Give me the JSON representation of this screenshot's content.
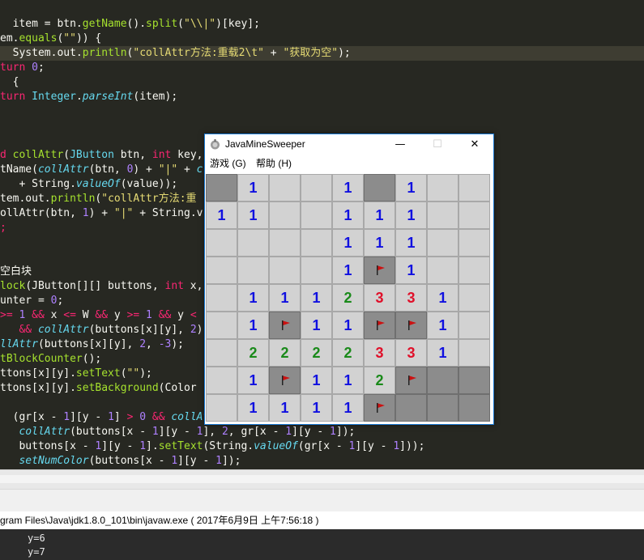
{
  "code": {
    "lines": [
      {
        "text": "",
        "parts": []
      },
      {
        "parts": [
          [
            "pl",
            "  item = btn."
          ],
          [
            "fn",
            "getName"
          ],
          [
            "pl",
            "()."
          ],
          [
            "fn",
            "split"
          ],
          [
            "pl",
            "("
          ],
          [
            "st",
            "\"\\\\|\""
          ],
          [
            "pl",
            ")["
          ],
          [
            "pl",
            "key"
          ],
          [
            "pl",
            "];"
          ]
        ]
      },
      {
        "parts": [
          [
            "pl",
            "em."
          ],
          [
            "fn",
            "equals"
          ],
          [
            "pl",
            "("
          ],
          [
            "st",
            "\"\""
          ],
          [
            "pl",
            ")) {"
          ]
        ]
      },
      {
        "hl": true,
        "parts": [
          [
            "pl",
            "  System.out."
          ],
          [
            "fn",
            "println"
          ],
          [
            "pl",
            "("
          ],
          [
            "st",
            "\"collAttr方法:重载2\\t\""
          ],
          [
            "pl",
            " + "
          ],
          [
            "st",
            "\"获取为空\""
          ],
          [
            "pl",
            ");"
          ]
        ]
      },
      {
        "parts": [
          [
            "kw",
            "turn"
          ],
          [
            "pl",
            " "
          ],
          [
            "nm",
            "0"
          ],
          [
            "pl",
            ";"
          ]
        ]
      },
      {
        "parts": [
          [
            "pl",
            "  {"
          ]
        ]
      },
      {
        "parts": [
          [
            "kw",
            "turn"
          ],
          [
            "pl",
            " "
          ],
          [
            "tyn",
            "Integer"
          ],
          [
            "pl",
            "."
          ],
          [
            "ty",
            "parseInt"
          ],
          [
            "pl",
            "(item);"
          ]
        ]
      },
      {
        "parts": []
      },
      {
        "parts": []
      },
      {
        "parts": []
      },
      {
        "parts": [
          [
            "kw",
            "d"
          ],
          [
            "pl",
            " "
          ],
          [
            "fn",
            "collAttr"
          ],
          [
            "pl",
            "("
          ],
          [
            "tyn",
            "JButton"
          ],
          [
            "pl",
            " btn, "
          ],
          [
            "kw",
            "int"
          ],
          [
            "pl",
            " key,"
          ]
        ]
      },
      {
        "parts": [
          [
            "pl",
            "tName("
          ],
          [
            "ty",
            "collAttr"
          ],
          [
            "pl",
            "(btn, "
          ],
          [
            "nm",
            "0"
          ],
          [
            "pl",
            ") + "
          ],
          [
            "st",
            "\"|\""
          ],
          [
            "pl",
            " + "
          ],
          [
            "ty",
            "c"
          ]
        ]
      },
      {
        "parts": [
          [
            "pl",
            "   + String."
          ],
          [
            "ty",
            "valueOf"
          ],
          [
            "pl",
            "(value));"
          ]
        ]
      },
      {
        "parts": [
          [
            "pl",
            "tem.out."
          ],
          [
            "fn",
            "println"
          ],
          [
            "pl",
            "("
          ],
          [
            "st",
            "\"collAttr方法:重"
          ]
        ]
      },
      {
        "parts": [
          [
            "pl",
            "ollAttr(btn, "
          ],
          [
            "nm",
            "1"
          ],
          [
            "pl",
            ") + "
          ],
          [
            "st",
            "\"|\""
          ],
          [
            "pl",
            " + String.v"
          ]
        ]
      },
      {
        "parts": [
          [
            "kw",
            ";"
          ]
        ]
      },
      {
        "parts": []
      },
      {
        "parts": []
      },
      {
        "parts": [
          [
            "pl",
            "空白块"
          ]
        ]
      },
      {
        "parts": [
          [
            "fn",
            "lock"
          ],
          [
            "pl",
            "(JButton[][] buttons, "
          ],
          [
            "kw",
            "int"
          ],
          [
            "pl",
            " x,"
          ]
        ]
      },
      {
        "parts": [
          [
            "pl",
            "unter = "
          ],
          [
            "nm",
            "0"
          ],
          [
            "pl",
            ";"
          ]
        ]
      },
      {
        "parts": [
          [
            "kw",
            ">="
          ],
          [
            "pl",
            " "
          ],
          [
            "nm",
            "1"
          ],
          [
            "pl",
            " "
          ],
          [
            "kw",
            "&&"
          ],
          [
            "pl",
            " x "
          ],
          [
            "kw",
            "<="
          ],
          [
            "pl",
            " W "
          ],
          [
            "kw",
            "&&"
          ],
          [
            "pl",
            " y "
          ],
          [
            "kw",
            ">="
          ],
          [
            "pl",
            " "
          ],
          [
            "nm",
            "1"
          ],
          [
            "pl",
            " "
          ],
          [
            "kw",
            "&&"
          ],
          [
            "pl",
            " y "
          ],
          [
            "kw",
            "<"
          ]
        ]
      },
      {
        "parts": [
          [
            "pl",
            "   "
          ],
          [
            "kw",
            "&&"
          ],
          [
            "pl",
            " "
          ],
          [
            "ty",
            "collAttr"
          ],
          [
            "pl",
            "(buttons[x][y], "
          ],
          [
            "nm",
            "2"
          ],
          [
            "pl",
            ")"
          ]
        ]
      },
      {
        "parts": [
          [
            "ty",
            "llAttr"
          ],
          [
            "pl",
            "(buttons[x][y], "
          ],
          [
            "nm",
            "2"
          ],
          [
            "pl",
            ", "
          ],
          [
            "nm",
            "-3"
          ],
          [
            "pl",
            ");"
          ]
        ]
      },
      {
        "parts": [
          [
            "fn",
            "tBlockCounter"
          ],
          [
            "pl",
            "();"
          ]
        ]
      },
      {
        "parts": [
          [
            "pl",
            "ttons[x][y]."
          ],
          [
            "fn",
            "setText"
          ],
          [
            "pl",
            "("
          ],
          [
            "st",
            "\"\""
          ],
          [
            "pl",
            ");"
          ]
        ]
      },
      {
        "parts": [
          [
            "pl",
            "ttons[x][y]."
          ],
          [
            "fn",
            "setBackground"
          ],
          [
            "pl",
            "(Color"
          ]
        ]
      },
      {
        "parts": []
      },
      {
        "parts": [
          [
            "pl",
            "  ("
          ],
          [
            "pl",
            "gr[x - "
          ],
          [
            "nm",
            "1"
          ],
          [
            "pl",
            "][y - "
          ],
          [
            "nm",
            "1"
          ],
          [
            "pl",
            "] "
          ],
          [
            "kw",
            ">"
          ],
          [
            "pl",
            " "
          ],
          [
            "nm",
            "0"
          ],
          [
            "pl",
            " "
          ],
          [
            "kw",
            "&&"
          ],
          [
            "pl",
            " "
          ],
          [
            "ty",
            "collAtt"
          ]
        ]
      },
      {
        "parts": [
          [
            "pl",
            "   "
          ],
          [
            "ty",
            "collAttr"
          ],
          [
            "pl",
            "(buttons[x - "
          ],
          [
            "nm",
            "1"
          ],
          [
            "pl",
            "][y - "
          ],
          [
            "nm",
            "1"
          ],
          [
            "pl",
            "], "
          ],
          [
            "nm",
            "2"
          ],
          [
            "pl",
            ", gr[x - "
          ],
          [
            "nm",
            "1"
          ],
          [
            "pl",
            "][y - "
          ],
          [
            "nm",
            "1"
          ],
          [
            "pl",
            "]);"
          ]
        ]
      },
      {
        "parts": [
          [
            "pl",
            "   buttons[x - "
          ],
          [
            "nm",
            "1"
          ],
          [
            "pl",
            "][y - "
          ],
          [
            "nm",
            "1"
          ],
          [
            "pl",
            "]."
          ],
          [
            "fn",
            "setText"
          ],
          [
            "pl",
            "(String."
          ],
          [
            "ty",
            "valueOf"
          ],
          [
            "pl",
            "(gr[x - "
          ],
          [
            "nm",
            "1"
          ],
          [
            "pl",
            "][y - "
          ],
          [
            "nm",
            "1"
          ],
          [
            "pl",
            "]));"
          ]
        ]
      },
      {
        "parts": [
          [
            "pl",
            "   "
          ],
          [
            "ty",
            "setNumColor"
          ],
          [
            "pl",
            "(buttons[x - "
          ],
          [
            "nm",
            "1"
          ],
          [
            "pl",
            "][y - "
          ],
          [
            "nm",
            "1"
          ],
          [
            "pl",
            "]);"
          ]
        ]
      }
    ]
  },
  "console": {
    "header": "gram Files\\Java\\jdk1.8.0_101\\bin\\javaw.exe ( 2017年6月9日 上午7:56:18 )",
    "lines": [
      "y=6",
      "y=7"
    ]
  },
  "window": {
    "title": "JavaMineSweeper",
    "minimize": "—",
    "maximize": "☐",
    "close": "✕",
    "menu": [
      {
        "label": "游戏 (G)"
      },
      {
        "label": "帮助 (H)"
      }
    ]
  },
  "colors": {
    "1": "#1010e0",
    "2": "#1a8a1a",
    "3": "#e0102a",
    "flag": "#cc1111"
  },
  "board": {
    "cols": 9,
    "rows": 9,
    "cells": [
      [
        "c",
        "1",
        "o",
        "o",
        "1",
        "c",
        "1",
        "o",
        "o"
      ],
      [
        "1",
        "1",
        "o",
        "o",
        "1",
        "1",
        "1",
        "o",
        "o"
      ],
      [
        "o",
        "o",
        "o",
        "o",
        "1",
        "1",
        "1",
        "o",
        "o"
      ],
      [
        "o",
        "o",
        "o",
        "o",
        "1",
        "F",
        "1",
        "o",
        "o"
      ],
      [
        "o",
        "1",
        "1",
        "1",
        "2",
        "3",
        "3",
        "1",
        "o"
      ],
      [
        "o",
        "1",
        "F",
        "1",
        "1",
        "F",
        "F",
        "1",
        "o"
      ],
      [
        "o",
        "2",
        "2",
        "2",
        "2",
        "3",
        "3",
        "1",
        "o"
      ],
      [
        "o",
        "1",
        "F",
        "1",
        "1",
        "2",
        "F",
        "c",
        "c"
      ],
      [
        "o",
        "1",
        "1",
        "1",
        "1",
        "F",
        "c",
        "c",
        "c"
      ]
    ]
  }
}
